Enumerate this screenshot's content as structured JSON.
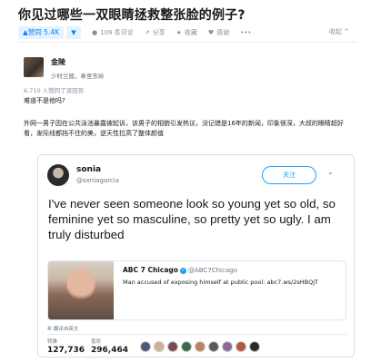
{
  "question": {
    "title": "你见过哪些一双眼睛拯救整张脸的例子?"
  },
  "actions": {
    "upvote": "▲赞同 5.4K",
    "downvote": "▼",
    "comments": "109 条评论",
    "share": "分享",
    "favorite": "收藏",
    "thanks": "感谢",
    "collapse": "收起 ^"
  },
  "author": {
    "name": "金陵",
    "bio": "少时兰陵，奉至东岭"
  },
  "answer": {
    "vote_count": "6,710 人赞同了该回答",
    "line1": "难道不是他吗?",
    "line2": "外网一男子因在公共泳池暴露被起诉，该男子的相貌引发热议，没记错是16年的新闻，印象很深，大叔的眼睛超好看，发际线都挡不住的美，逆天性拉高了整体颜值"
  },
  "tweet": {
    "name": "sonia",
    "handle": "@sxniagarcia",
    "follow": "关注",
    "text": "I've never seen someone look so young yet so old, so feminine yet so masculine, so pretty yet so ugly. I am truly disturbed",
    "quote": {
      "name": "ABC 7 Chicago",
      "verified": "✓",
      "handle": "@ABC7Chicago",
      "text": "Man accused of exposing himself at public pool: abc7.ws/2sHBQjT"
    },
    "time": "翻译自英文",
    "retweets_label": "转推",
    "retweets": "127,736",
    "likes_label": "喜欢",
    "likes": "296,464"
  },
  "colors": {
    "accent": "#0084ff",
    "twitter_blue": "#1da1f2",
    "muted": "#8590a6"
  }
}
